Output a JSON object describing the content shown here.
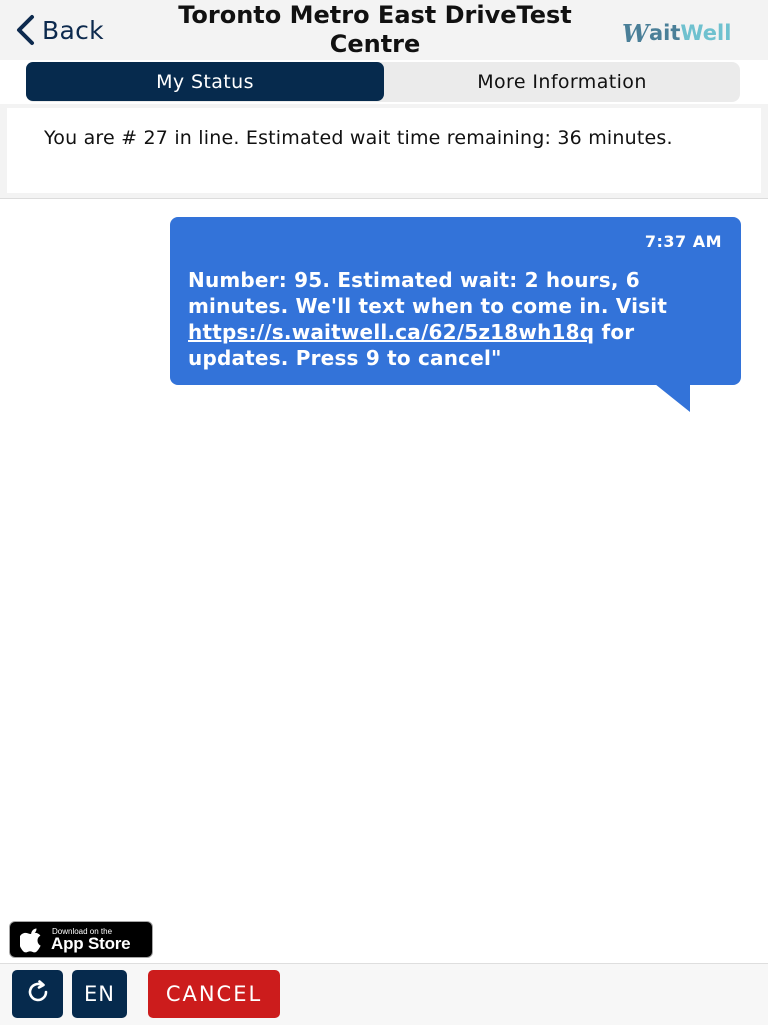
{
  "header": {
    "back_label": "Back",
    "title": "Toronto Metro East DriveTest Centre",
    "brand": {
      "w": "W",
      "ait": "ait",
      "well": "Well"
    }
  },
  "tabs": [
    {
      "label": "My Status",
      "active": true
    },
    {
      "label": "More Information",
      "active": false
    }
  ],
  "status": {
    "text": "You are # 27 in line. Estimated wait time remaining: 36 minutes."
  },
  "message": {
    "time": "7:37 AM",
    "text_before": "Number: 95. Estimated wait: 2 hours, 6 minutes. We'll text when to come in. Visit ",
    "link": "https://s.waitwell.ca/62/5z18wh18q",
    "text_after": " for updates. Press 9 to cancel\""
  },
  "app_store": {
    "small": "Download on the",
    "big": "App Store"
  },
  "footer": {
    "language": "EN",
    "cancel_label": "CANCEL"
  },
  "colors": {
    "navy": "#062a4d",
    "bubble": "#3373d9",
    "cancel": "#cc1c1c",
    "brand_teal": "#4a7f98",
    "brand_light": "#6fc1cf"
  },
  "icons": {
    "back": "chevron-left-icon",
    "refresh": "refresh-icon",
    "apple": "apple-logo-icon"
  }
}
